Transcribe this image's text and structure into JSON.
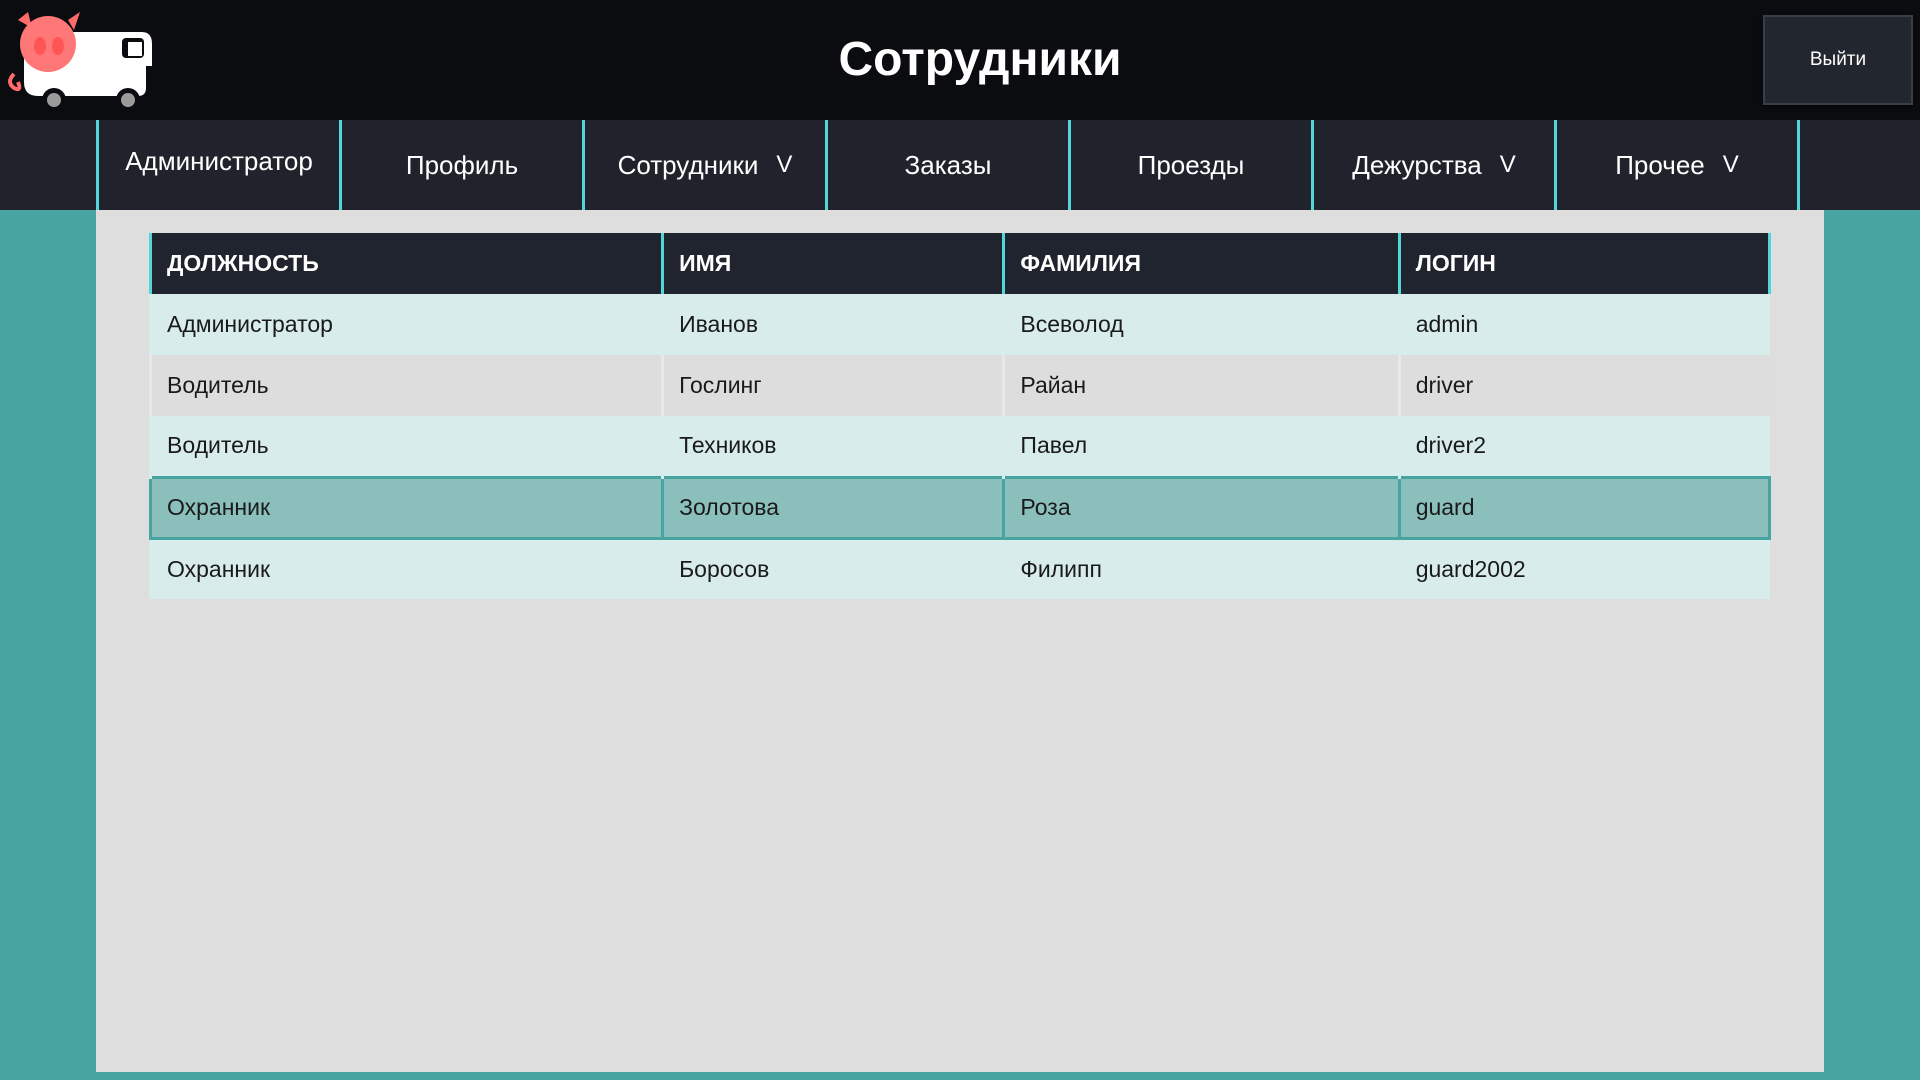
{
  "header": {
    "title": "Сотрудники",
    "logout_label": "Выйти"
  },
  "nav": {
    "items": [
      {
        "label": "Администратор",
        "has_dropdown": false
      },
      {
        "label": "Профиль",
        "has_dropdown": false
      },
      {
        "label": "Сотрудники",
        "has_dropdown": true
      },
      {
        "label": "Заказы",
        "has_dropdown": false
      },
      {
        "label": "Проезды",
        "has_dropdown": false
      },
      {
        "label": "Дежурства",
        "has_dropdown": true
      },
      {
        "label": "Прочее",
        "has_dropdown": true
      }
    ],
    "dropdown_glyph": "V"
  },
  "table": {
    "columns": [
      "ДОЛЖНОСТЬ",
      "ИМЯ",
      "ФАМИЛИЯ",
      "ЛОГИН"
    ],
    "rows": [
      {
        "position": "Администратор",
        "name": "Иванов",
        "surname": "Всеволод",
        "login": "admin"
      },
      {
        "position": "Водитель",
        "name": "Гослинг",
        "surname": "Райан",
        "login": "driver"
      },
      {
        "position": "Водитель",
        "name": "Техников",
        "surname": "Павел",
        "login": "driver2"
      },
      {
        "position": "Охранник",
        "name": "Золотова",
        "surname": "Роза",
        "login": "guard"
      },
      {
        "position": "Охранник",
        "name": "Боросов",
        "surname": "Филипп",
        "login": "guard2002"
      }
    ],
    "selected_row": 3
  },
  "colors": {
    "accent": "#52d6d8",
    "background_teal": "#47a4a0",
    "header_bg": "#0a0c10",
    "nav_bg": "#20232b",
    "selected_row": "#8bbfbb"
  },
  "icons": {
    "logo": "pig-truck-logo-icon",
    "dropdown": "chevron-down-icon"
  }
}
